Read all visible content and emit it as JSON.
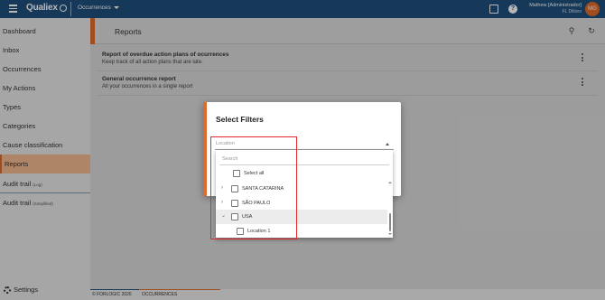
{
  "topbar": {
    "brand": "Qualiex",
    "module": "Occurrences",
    "user_name": "Mathew [Administrador]",
    "user_org": "FL Diltoro",
    "avatar_initials": "MG"
  },
  "sidebar": {
    "items": [
      {
        "label": "Dashboard",
        "suffix": ""
      },
      {
        "label": "Inbox",
        "suffix": ""
      },
      {
        "label": "Occurrences",
        "suffix": ""
      },
      {
        "label": "My Actions",
        "suffix": ""
      },
      {
        "label": "Types",
        "suffix": ""
      },
      {
        "label": "Categories",
        "suffix": ""
      },
      {
        "label": "Cause classification",
        "suffix": ""
      },
      {
        "label": "Reports",
        "suffix": ""
      },
      {
        "label": "Audit trail",
        "suffix": "(Log)"
      },
      {
        "label": "Audit trail",
        "suffix": "(Simplified)"
      }
    ],
    "settings_label": "Settings"
  },
  "page": {
    "title": "Reports"
  },
  "reports": [
    {
      "title": "Report of overdue action plans of ocurrences",
      "description": "Keep track of all action plans that are late."
    },
    {
      "title": "General occurrence report",
      "description": "All your occurrences in a single report"
    }
  ],
  "footer": {
    "copyright": "© FORLOGIC 2026",
    "tab": "OCCURRENCES"
  },
  "dialog": {
    "title": "Select Filters",
    "location_label": "Location"
  },
  "dropdown": {
    "search_placeholder": "Search",
    "select_all": "Select all",
    "items": [
      {
        "label": "SANTA CATARINA"
      },
      {
        "label": "SÃO PAULO"
      },
      {
        "label": "USA"
      },
      {
        "label": "Location 1"
      }
    ]
  },
  "colors": {
    "topbar": "#1f4f7c",
    "accent": "#e06a2b",
    "active_nav": "#f2b98f",
    "highlight_box": "#e0282f"
  }
}
